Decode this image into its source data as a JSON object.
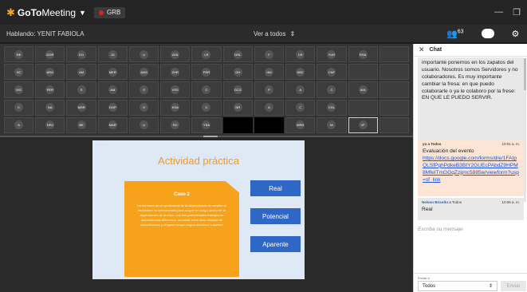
{
  "titlebar": {
    "app_name_prefix": "GoTo",
    "app_name_suffix": "Meeting",
    "rec_label": "GRB",
    "minimize": "—",
    "restore": "❐"
  },
  "statusbar": {
    "speaking": "Hablando: YENIT FABIOLA",
    "view_mode": "Ver a todos",
    "attendee_count": "63"
  },
  "grid": {
    "tiles": [
      "RE",
      "DOR",
      "EO",
      "JG",
      "U",
      "AYA",
      "LR",
      "DRL",
      "F",
      "CR",
      "YUR",
      "RSA",
      "",
      "SC",
      "ARG",
      "AM",
      "MER",
      "ANG",
      "ZHR",
      "PSR",
      "GH",
      "HM",
      "SBC",
      "CNF",
      "",
      "",
      "MG",
      "PER",
      "S",
      "AM",
      "S",
      "VSS",
      "C",
      "GCS",
      "P",
      "A",
      "C",
      "IAN",
      "",
      "C",
      "NA",
      "MSR",
      "DGP",
      "O",
      "KSA",
      "C",
      "NR",
      "A",
      "C",
      "CDL",
      "",
      "",
      "A",
      "DRJ",
      "BE",
      "MAR",
      "U",
      "RC",
      "YSA",
      "",
      "YCI",
      "MRN",
      "IA",
      "VF",
      ""
    ]
  },
  "slide": {
    "tiny_text": "·· ····· ····",
    "title": "Actividad práctica",
    "case_title": "Caso 2",
    "case_body": "La hermana de un profesional de la dependencia de servicio al ciudadano es seleccionada para ocupar un cargo dentro de la dependencia de archivo. Los dos profesionales trabajan en dependencias diferentes, no existe entre ellos relación de subordinación y ninguno ocupa cargos directivos o asesor.",
    "options": [
      "Real",
      "Potencial",
      "Aparente"
    ]
  },
  "chat": {
    "title": "Chat",
    "msg1_text": "importante ponernos en los zapatos del usuario.  Nosotros somos Servidores y no colaboradores. Es muy importante cambiar la fresa: en que puedo colaborarle o ya le colaboro por la frese: EN QUE LE PUEDO SERVIR.",
    "msg2_sender": "yo a Todos",
    "msg2_time": "10:01 a. m.",
    "msg2_text": "Evaluación del evento",
    "msg2_link": "https://docs.google.com/forms/d/e/1FAIpQLSfPghPdkeB3BIY2GUEcPAbdZ9HPM8MfeITmGGqZzjjmc5885w/viewform?usp=sf_link",
    "msg3_sender": "Nelson Briceño",
    "msg3_to": " a Todos",
    "msg3_time": "10:06 a. m.",
    "msg3_text": "Real",
    "compose_placeholder": "Escriba su mensaje",
    "send_to_label": "Enviar a",
    "send_to_value": "Todos",
    "send_button": "Enviar"
  },
  "colors": {
    "accent_orange": "#f7a21b",
    "button_blue": "#2e67c6",
    "rec_red": "#e02020"
  }
}
